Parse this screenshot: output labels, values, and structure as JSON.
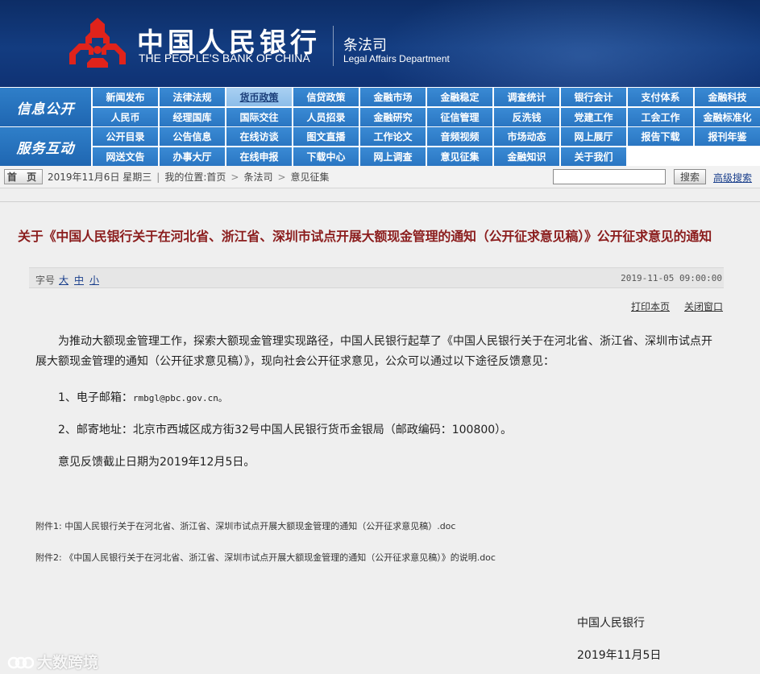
{
  "header": {
    "bank_cn": "中国人民银行",
    "bank_en": "THE PEOPLE'S BANK OF CHINA",
    "dept_cn": "条法司",
    "dept_en": "Legal Affairs Department",
    "logo_icon": "pboc-logo-icon"
  },
  "nav": {
    "row1_label": "信息公开",
    "row2_label": "服务互动",
    "row1_items": [
      "新闻发布",
      "法律法规",
      "货币政策",
      "信贷政策",
      "金融市场",
      "金融稳定",
      "调查统计",
      "银行会计",
      "支付体系",
      "金融科技",
      "人民币",
      "经理国库",
      "国际交往",
      "人员招录",
      "金融研究",
      "征信管理",
      "反洗钱",
      "党建工作",
      "工会工作",
      "金融标准化"
    ],
    "row2_items": [
      "公开目录",
      "公告信息",
      "在线访谈",
      "图文直播",
      "工作论文",
      "音频视频",
      "市场动态",
      "网上展厅",
      "报告下载",
      "报刊年鉴",
      "网送文告",
      "办事大厅",
      "在线申报",
      "下载中心",
      "网上调查",
      "意见征集",
      "金融知识",
      "关于我们",
      "",
      ""
    ]
  },
  "crumb": {
    "home": "首 页",
    "date": "2019年11月6日 星期三",
    "location_label": "我的位置:",
    "items": [
      "首页",
      "条法司",
      "意见征集"
    ],
    "search_button": "搜索",
    "advanced_search": "高级搜索",
    "search_value": ""
  },
  "article": {
    "title": "关于《中国人民银行关于在河北省、浙江省、深圳市试点开展大额现金管理的通知（公开征求意见稿）》公开征求意见的通知",
    "font_size_label": "字号",
    "font_options": [
      "大",
      "中",
      "小"
    ],
    "date": "2019-11-05 09:00:00",
    "print": "打印本页",
    "close": "关闭窗口",
    "para1_line1": "为推动大额现金管理工作，探索大额现金管理实现路径，中国人民银行起草了《中国人民银行关于在河北省、浙江省、深圳市试点开",
    "para1_line2": "展大额现金管理的通知（公开征求意见稿）》，现向社会公开征求意见，公众可以通过以下途径反馈意见：",
    "item1_label": "1、电子邮箱：",
    "item1_email": "rmbgl@pbc.gov.cn。",
    "item2": "2、邮寄地址：北京市西城区成方街32号中国人民银行货币金银局（邮政编码：100800）。",
    "deadline": "意见反馈截止日期为2019年12月5日。",
    "attachment1": "附件1: 中国人民银行关于在河北省、浙江省、深圳市试点开展大额现金管理的通知（公开征求意见稿）.doc",
    "attachment2": "附件2: 《中国人民银行关于在河北省、浙江省、深圳市试点开展大额现金管理的通知（公开征求意见稿）》的说明.doc",
    "signer": "中国人民银行",
    "sign_date": "2019年11月5日"
  },
  "watermark": "大数跨境",
  "colors": {
    "header_bg": "#133c80",
    "nav_cell": "#2a76c2",
    "title": "#8b1d1d",
    "link": "#1a3f8c"
  }
}
